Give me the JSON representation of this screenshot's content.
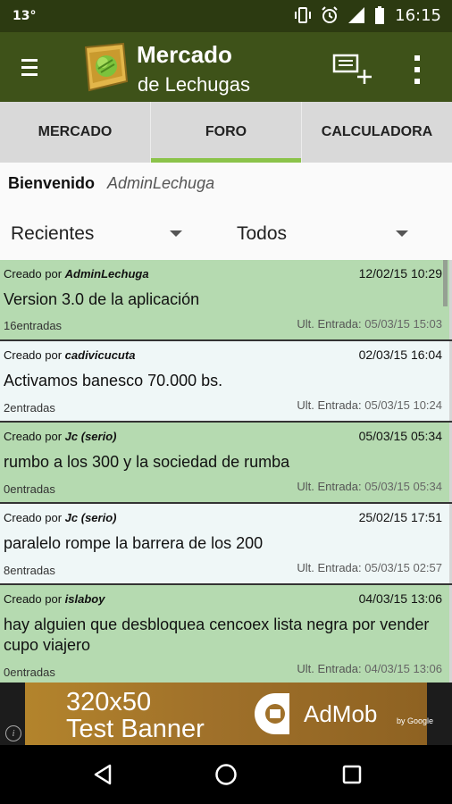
{
  "status_bar": {
    "left": "13°",
    "time": "16:15"
  },
  "app": {
    "title": "Mercado",
    "subtitle": "de Lechugas"
  },
  "tabs": [
    {
      "label": "MERCADO"
    },
    {
      "label": "FORO"
    },
    {
      "label": "CALCULADORA"
    }
  ],
  "welcome": {
    "label": "Bienvenido",
    "user": "AdminLechuga"
  },
  "filters": {
    "sort": "Recientes",
    "scope": "Todos"
  },
  "posts": [
    {
      "created_by_label": "Creado por",
      "author": "AdminLechuga",
      "date": "12/02/15 10:29",
      "title": "Version 3.0 de la aplicación",
      "count": "16entradas",
      "last_label": "Ult. Entrada:",
      "last": "05/03/15 15:03"
    },
    {
      "created_by_label": "Creado por",
      "author": "cadivicucuta",
      "date": "02/03/15 16:04",
      "title": "Activamos banesco 70.000 bs.",
      "count": "2entradas",
      "last_label": "Ult. Entrada:",
      "last": "05/03/15 10:24"
    },
    {
      "created_by_label": "Creado por",
      "author": "Jc (serio)",
      "date": "05/03/15 05:34",
      "title": "rumbo a los 300 y la sociedad de rumba",
      "count": "0entradas",
      "last_label": "Ult. Entrada:",
      "last": "05/03/15 05:34"
    },
    {
      "created_by_label": "Creado por",
      "author": "Jc (serio)",
      "date": "25/02/15 17:51",
      "title": "paralelo rompe la barrera de los 200",
      "count": "8entradas",
      "last_label": "Ult. Entrada:",
      "last": "05/03/15 02:57"
    },
    {
      "created_by_label": "Creado por",
      "author": "islaboy",
      "date": "04/03/15 13:06",
      "title": "hay alguien que desbloquea cencoex lista negra por vender cupo viajero",
      "count": "0entradas",
      "last_label": "Ult. Entrada:",
      "last": "04/03/15 13:06"
    }
  ],
  "ad": {
    "line1": "320x50",
    "line2": "Test Banner",
    "brand": "AdMob",
    "by": "by Google",
    "info": "i"
  },
  "colors": {
    "status_bar": "#2c3a11",
    "app_bar": "#3e5219",
    "tab_indicator": "#8bc34a",
    "post_green": "#b5dab0",
    "post_white": "#eff7f7"
  }
}
